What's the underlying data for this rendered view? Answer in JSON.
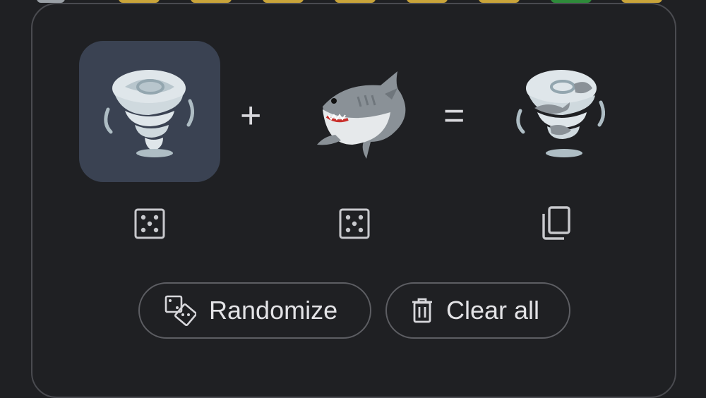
{
  "emoji_kitchen": {
    "left": {
      "emoji": "tornado"
    },
    "plus": "+",
    "right": {
      "emoji": "shark"
    },
    "equals": "=",
    "result": {
      "emoji": "tornado-shark"
    }
  },
  "actions": {
    "randomize_label": "Randomize",
    "clear_label": "Clear all"
  },
  "colors": {
    "background": "#1f2023",
    "selected_slot": "#3a4252",
    "border": "#5d5e63"
  }
}
